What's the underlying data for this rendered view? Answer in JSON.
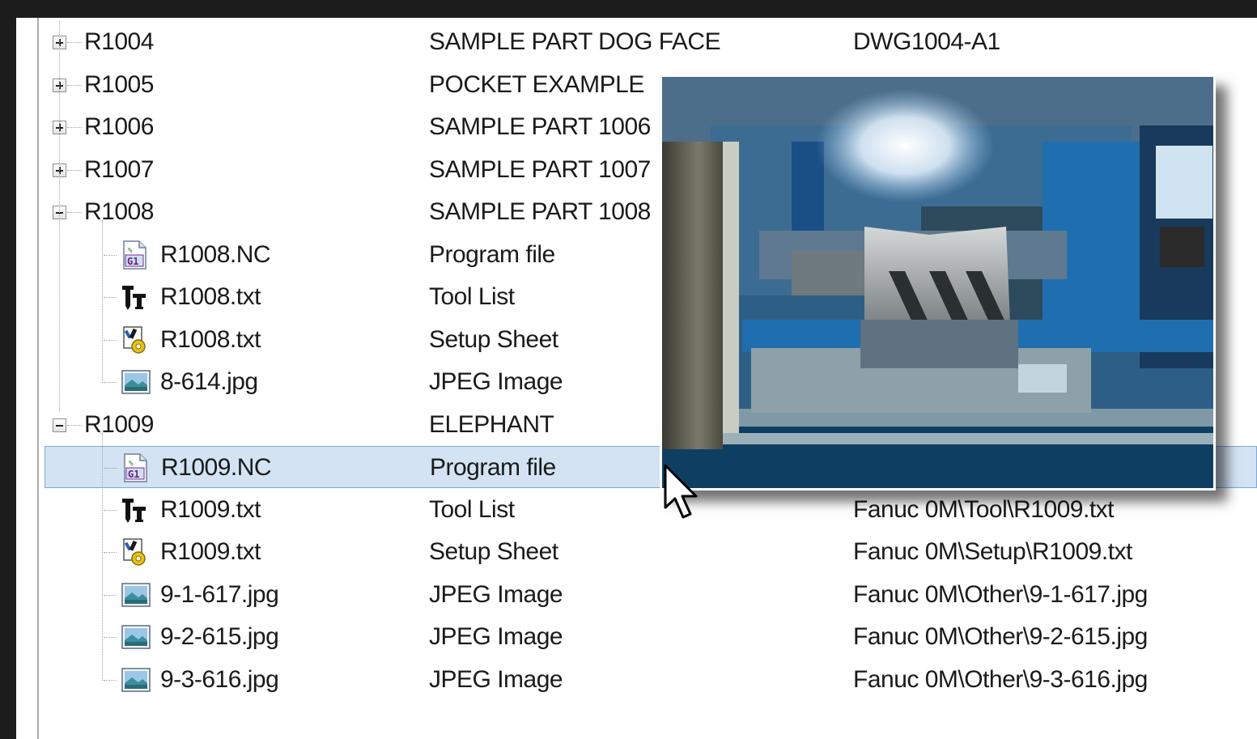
{
  "rows": [
    {
      "name": "R1004",
      "desc": "SAMPLE PART DOG FACE",
      "path": "DWG1004-A1",
      "type": "folder",
      "expanded": false
    },
    {
      "name": "R1005",
      "desc": "POCKET EXAMPLE",
      "path": "",
      "type": "folder",
      "expanded": false
    },
    {
      "name": "R1006",
      "desc": "SAMPLE PART 1006",
      "path": "",
      "type": "folder",
      "expanded": false
    },
    {
      "name": "R1007",
      "desc": "SAMPLE PART 1007",
      "path": "",
      "type": "folder",
      "expanded": false
    },
    {
      "name": "R1008",
      "desc": "SAMPLE PART 1008",
      "path": "",
      "type": "folder",
      "expanded": true
    },
    {
      "name": "R1008.NC",
      "desc": "Program file",
      "path": "",
      "type": "nc-file"
    },
    {
      "name": "R1008.txt",
      "desc": "Tool List",
      "path": "",
      "type": "tool-list"
    },
    {
      "name": "R1008.txt",
      "desc": "Setup Sheet",
      "path": "",
      "type": "setup-sheet"
    },
    {
      "name": "8-614.jpg",
      "desc": "JPEG Image",
      "path": "",
      "type": "jpeg"
    },
    {
      "name": "R1009",
      "desc": "ELEPHANT",
      "path": "",
      "type": "folder",
      "expanded": true
    },
    {
      "name": "R1009.NC",
      "desc": "Program file",
      "path": "",
      "type": "nc-file",
      "selected": true
    },
    {
      "name": "R1009.txt",
      "desc": "Tool List",
      "path": "Fanuc 0M\\Tool\\R1009.txt",
      "type": "tool-list"
    },
    {
      "name": "R1009.txt",
      "desc": "Setup Sheet",
      "path": "Fanuc 0M\\Setup\\R1009.txt",
      "type": "setup-sheet"
    },
    {
      "name": "9-1-617.jpg",
      "desc": "JPEG Image",
      "path": "Fanuc 0M\\Other\\9-1-617.jpg",
      "type": "jpeg"
    },
    {
      "name": "9-2-615.jpg",
      "desc": "JPEG Image",
      "path": "Fanuc 0M\\Other\\9-2-615.jpg",
      "type": "jpeg"
    },
    {
      "name": "9-3-616.jpg",
      "desc": "JPEG Image",
      "path": "Fanuc 0M\\Other\\9-3-616.jpg",
      "type": "jpeg"
    }
  ],
  "colors": {
    "selection_bg": "#d3e3f3",
    "selection_border": "#7ea9d6",
    "machine_blue": "#1f6fb0",
    "background": "#1c1c1c"
  },
  "preview": {
    "icon": "machine-photo-preview"
  }
}
